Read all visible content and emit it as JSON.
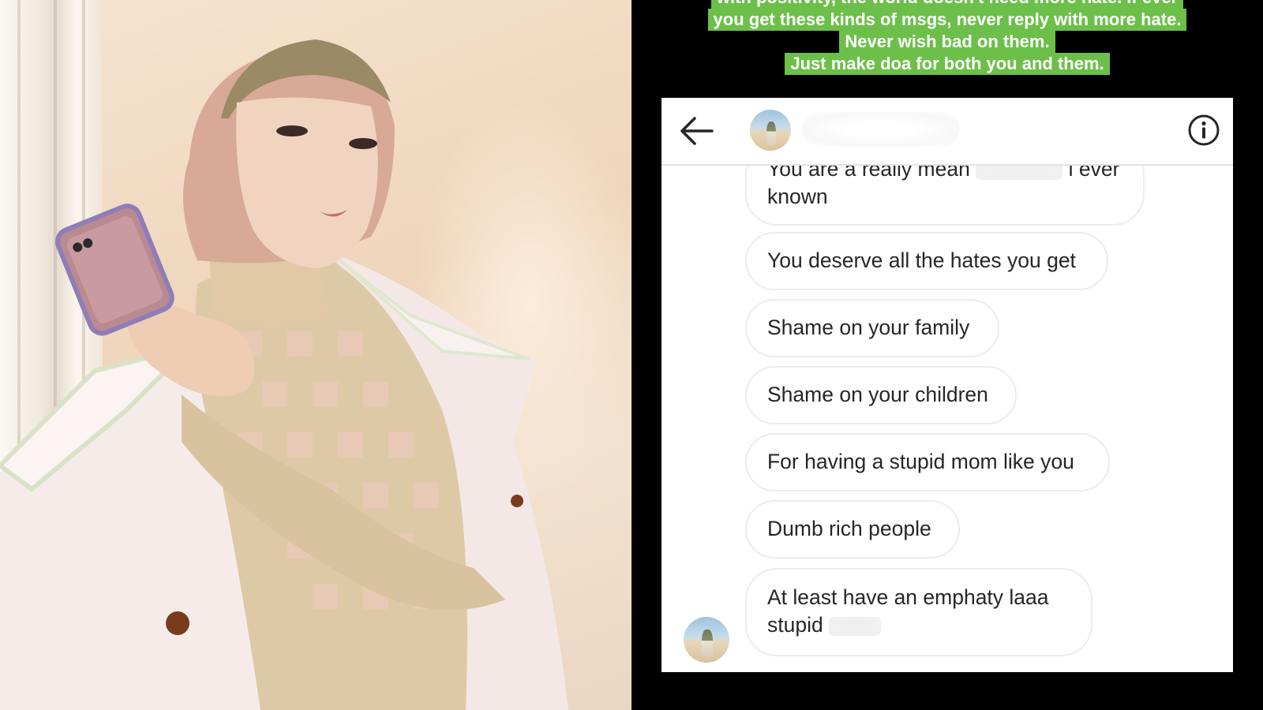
{
  "caption": {
    "lines": [
      "with positivity, the world doesn't need more hate. If ever",
      "you get these kinds of msgs, never reply with more hate.",
      "Never wish bad on them.",
      "Just make doa for both you and them."
    ],
    "highlight_color": "#6cc04a"
  },
  "chat": {
    "header": {
      "back_icon": "arrow-left-icon",
      "info_icon": "info-circle-icon"
    },
    "messages": [
      {
        "line1_before": "You are a really mean",
        "line1_after": "i ever",
        "line2": "known"
      },
      {
        "text": "You deserve all the hates you get"
      },
      {
        "text": "Shame on your family"
      },
      {
        "text": "Shame on your children"
      },
      {
        "text": "For having a stupid mom like you"
      },
      {
        "text": "Dumb rich people"
      },
      {
        "line1": "At least have an emphaty  laaa",
        "line2_before": "stupid"
      }
    ]
  },
  "colors": {
    "panel_background": "#000000",
    "bubble_border": "#ececec",
    "message_text": "#262626"
  }
}
